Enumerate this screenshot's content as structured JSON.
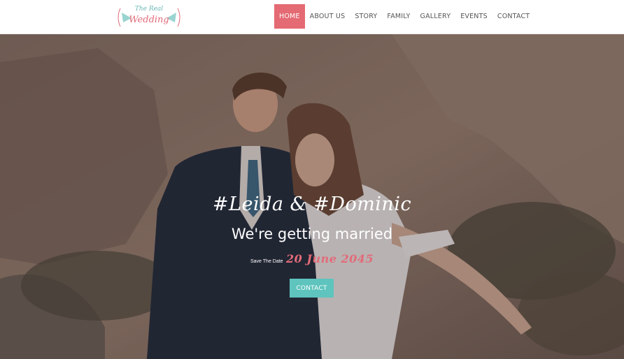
{
  "logo": {
    "line1": "The Real",
    "line2": "Wedding"
  },
  "nav": {
    "items": [
      {
        "label": "HOME"
      },
      {
        "label": "ABOUT US"
      },
      {
        "label": "STORY"
      },
      {
        "label": "FAMILY"
      },
      {
        "label": "GALLERY"
      },
      {
        "label": "EVENTS"
      },
      {
        "label": "CONTACT"
      }
    ],
    "active_index": 0
  },
  "hero": {
    "names": "#Leida  &  #Dominic",
    "tagline": "We're getting married",
    "save_label": "Save The Date",
    "date": "20  June  2045",
    "cta_label": "CONTACT"
  },
  "colors": {
    "accent_pink": "#e46a73",
    "accent_teal": "#5ec4bd"
  }
}
